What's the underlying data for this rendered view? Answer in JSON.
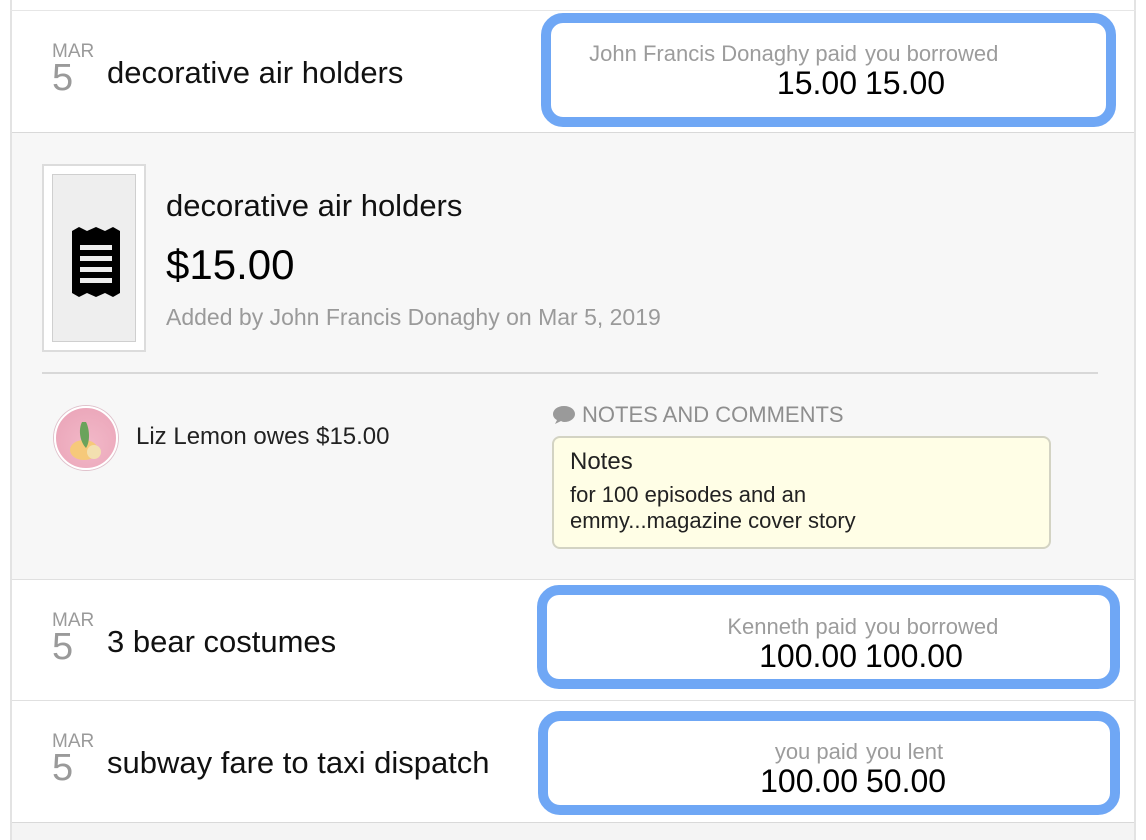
{
  "expenses": [
    {
      "month": "MAR",
      "day": "5",
      "description": "decorative air holders",
      "left_label": "John Francis Donaghy paid",
      "left_value": "15.00",
      "right_label": "you borrowed",
      "right_value": "15.00"
    },
    {
      "month": "MAR",
      "day": "5",
      "description": "3 bear costumes",
      "left_label": "Kenneth paid",
      "left_value": "100.00",
      "right_label": "you borrowed",
      "right_value": "100.00"
    },
    {
      "month": "MAR",
      "day": "5",
      "description": "subway fare to taxi dispatch",
      "left_label": "you paid",
      "left_value": "100.00",
      "right_label": "you lent",
      "right_value": "50.00"
    }
  ],
  "detail": {
    "title": "decorative air holders",
    "amount": "$15.00",
    "added_by": "Added by John Francis Donaghy on Mar 5, 2019",
    "owes": "Liz Lemon owes $15.00",
    "notes_header": "NOTES AND COMMENTS",
    "notes_title": "Notes",
    "notes_text": "for 100 episodes and an emmy...magazine cover story",
    "receipt_icon": "receipt-icon",
    "comment_icon": "speech-bubble-icon"
  },
  "colors": {
    "highlight": "#6fa7f5",
    "notes_bg": "#fffee6",
    "muted_text": "#9a9a9a"
  }
}
